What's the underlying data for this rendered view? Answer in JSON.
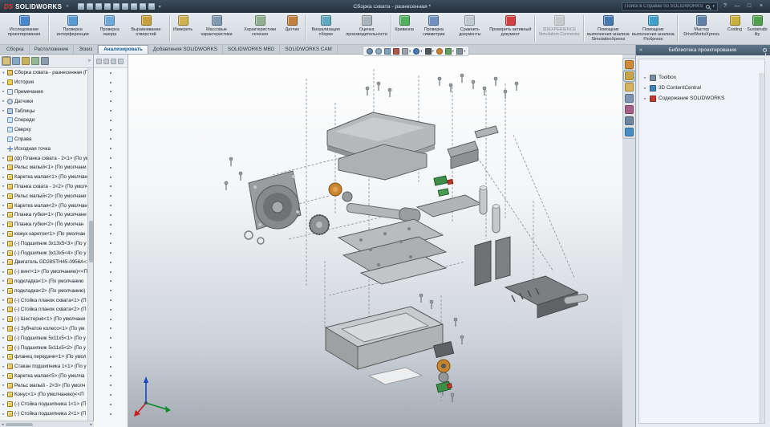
{
  "glyphs": {
    "dropdown": "▾",
    "expand": "▸",
    "expand_open": "▾",
    "chevron_left": "«",
    "chevron_right": "»",
    "scroll_left": "◂",
    "scroll_right": "▸"
  },
  "titlebar": {
    "logo_primary": "DS",
    "logo_name": "SOLIDWORKS",
    "doc_title": "Сборка схвата - разнесенная *",
    "search": {
      "placeholder": "Поиск в Справке по SOLIDWORKS"
    },
    "quick_access": [
      "new-document-icon",
      "open-icon",
      "save-icon",
      "print-icon",
      "undo-icon",
      "select-icon",
      "rebuild-icon",
      "file-properties-icon",
      "options-icon"
    ],
    "window_controls": {
      "help": "?",
      "dropdown": "▾",
      "min": "—",
      "max": "□",
      "close": "×"
    }
  },
  "ribbon": {
    "tools": [
      {
        "label": "Исследование проектирования",
        "icon": "design-study-icon",
        "color": "#4a86c8",
        "sep": true
      },
      {
        "label": "Проверка интерференции",
        "icon": "interference-check-icon",
        "color": "#5a9ad0"
      },
      {
        "label": "Проверка зазора",
        "icon": "clearance-check-icon",
        "color": "#70a8d8"
      },
      {
        "label": "Выравнивание отверстий",
        "icon": "hole-alignment-icon",
        "color": "#c8a040",
        "sep": true
      },
      {
        "label": "Измерить",
        "icon": "measure-icon",
        "color": "#d0b050"
      },
      {
        "label": "Массовые характеристики",
        "icon": "mass-properties-icon",
        "color": "#8098b0"
      },
      {
        "label": "Характеристики сечения",
        "icon": "section-properties-icon",
        "color": "#90b090"
      },
      {
        "label": "Датчик",
        "icon": "sensor-icon",
        "color": "#c08040",
        "sep": true
      },
      {
        "label": "Визуализация сборки",
        "icon": "assembly-visualization-icon",
        "color": "#60a8c0"
      },
      {
        "label": "Оценка производительности",
        "icon": "performance-evaluation-icon",
        "color": "#aab4bc",
        "sep": true
      },
      {
        "label": "Кривизна",
        "icon": "curvature-icon",
        "color": "#50b060"
      },
      {
        "label": "Проверка симметрии",
        "icon": "symmetry-check-icon",
        "color": "#7090c0"
      },
      {
        "label": "Сравнить документы",
        "icon": "compare-documents-icon",
        "color": "#c0c8d0"
      },
      {
        "label": "Проверить активный документ",
        "icon": "check-active-document-icon",
        "color": "#d04040",
        "sep": true
      },
      {
        "label": "3DEXPERIENCE Simulation Connector",
        "icon": "simulation-connector-icon",
        "color": "#a8b0b8",
        "disabled": true,
        "sep": true
      },
      {
        "label": "Помощник выполнения анализа SimulationXpress",
        "icon": "simulationxpress-icon",
        "color": "#4878b0"
      },
      {
        "label": "Помощник выполнения анализа FloXpress",
        "icon": "floxpress-icon",
        "color": "#40a0c8",
        "sep": true
      },
      {
        "label": "Мастер DriveWorksXpress",
        "icon": "driveworksxpress-icon",
        "color": "#6080a8"
      },
      {
        "label": "Costing",
        "icon": "costing-icon",
        "color": "#c8b040"
      },
      {
        "label": "Sustainability",
        "icon": "sustainability-icon",
        "color": "#50a050"
      }
    ]
  },
  "tabs": {
    "active_index": 3,
    "items": [
      "Сборка",
      "Расположение",
      "Эскиз",
      "Анализировать",
      "Добавления SOLIDWORKS",
      "SOLIDWORKS MBD",
      "SOLIDWORKS CAM"
    ]
  },
  "headsup": {
    "icons": [
      {
        "name": "zoom-fit-icon",
        "color": "#6b8aa8",
        "round": true
      },
      {
        "name": "zoom-area-icon",
        "color": "#8fa8c0",
        "round": true
      },
      {
        "name": "previous-view-icon",
        "color": "#7fa0c0"
      },
      {
        "name": "section-view-icon",
        "color": "#b05a4a"
      },
      {
        "name": "view-orientation-icon",
        "color": "#9aa4ae",
        "dd": true
      },
      {
        "name": "display-style-icon",
        "color": "#4a7ab0",
        "dd": true,
        "round": true
      },
      {
        "name": "hide-show-items-icon",
        "color": "#50585e",
        "dd": true
      },
      {
        "name": "edit-appearance-icon",
        "color": "#d08030",
        "round": true
      },
      {
        "name": "apply-scene-icon",
        "color": "#60a060",
        "dd": true
      },
      {
        "name": "view-settings-icon",
        "color": "#8090a0",
        "dd": true
      }
    ]
  },
  "feature_panel": {
    "tab_icons": [
      {
        "name": "feature-tree-icon",
        "color": "#d7c17a",
        "active": true
      },
      {
        "name": "property-manager-icon",
        "color": "#86a7c6"
      },
      {
        "name": "configuration-manager-icon",
        "color": "#c9b05e"
      },
      {
        "name": "dimxpert-manager-icon",
        "color": "#93b893"
      },
      {
        "name": "display-manager-icon",
        "color": "#8a9cae"
      }
    ],
    "tree": [
      {
        "label": "Сборка схвата - разнесенная  (По у",
        "icon": "assembly",
        "arrow": "▾"
      },
      {
        "label": "История",
        "icon": "folder",
        "arrow": "▸"
      },
      {
        "label": "Примечания",
        "icon": "annotations",
        "arrow": "▸"
      },
      {
        "label": "Датчики",
        "icon": "sensors",
        "arrow": "▸"
      },
      {
        "label": "Таблицы",
        "icon": "tables",
        "arrow": "▸"
      },
      {
        "label": "Спереди",
        "icon": "plane",
        "arrow": ""
      },
      {
        "label": "Сверху",
        "icon": "plane",
        "arrow": ""
      },
      {
        "label": "Справа",
        "icon": "plane",
        "arrow": ""
      },
      {
        "label": "Исходная точка",
        "icon": "origin",
        "arrow": ""
      },
      {
        "label": "(ф) Планка схвата - 2<1> (По ум",
        "icon": "part",
        "arrow": "▸"
      },
      {
        "label": "Рельс малый<1> (По умолчани",
        "icon": "part",
        "arrow": "▸"
      },
      {
        "label": "Каретка малая<1> (По умолчан",
        "icon": "part",
        "arrow": "▸"
      },
      {
        "label": "Планка схвата - 1<2> (По умолч",
        "icon": "part",
        "arrow": "▸"
      },
      {
        "label": "Рельс малый<2> (По умолчани",
        "icon": "part",
        "arrow": "▸"
      },
      {
        "label": "Каретка малая<2> (По умолчан",
        "icon": "part",
        "arrow": "▸"
      },
      {
        "label": "Планка губки<1> (По умолчани",
        "icon": "part",
        "arrow": "▸"
      },
      {
        "label": "Планка губки<2> (По умолчан",
        "icon": "part",
        "arrow": "▸"
      },
      {
        "label": "кожух кареток<1> (По умолчан",
        "icon": "part",
        "arrow": "▸"
      },
      {
        "label": "(-) Подшипник 3x13x5<3> (По у",
        "icon": "part",
        "arrow": "▸"
      },
      {
        "label": "(-) Подшипник 3x13x5<4> (По у",
        "icon": "part",
        "arrow": "▸"
      },
      {
        "label": "Двигатель GD28STH45-0956A<1",
        "icon": "part",
        "arrow": "▸"
      },
      {
        "label": "(-) винт<1> (По умолчанию)<<П",
        "icon": "part",
        "arrow": "▸"
      },
      {
        "label": "подкладка<1> (По умолчанию",
        "icon": "part",
        "arrow": "▸"
      },
      {
        "label": "подкладка<2> (По умолчанию)",
        "icon": "part",
        "arrow": "▸"
      },
      {
        "label": "(-) Стойка планок схвата<1> (П",
        "icon": "part",
        "arrow": "▸"
      },
      {
        "label": "(-) Стойка планок схвата<2> (П",
        "icon": "part",
        "arrow": "▸"
      },
      {
        "label": "(-) Шестерня<1> (По умолчани",
        "icon": "part",
        "arrow": "▸"
      },
      {
        "label": "(-) Зубчатое колесо<1> (По ум",
        "icon": "part",
        "arrow": "▸"
      },
      {
        "label": "(-) Подшипник 5x11x5<1> (По у",
        "icon": "part",
        "arrow": "▸"
      },
      {
        "label": "(-) Подшипник 5x11x5<2> (По у",
        "icon": "part",
        "arrow": "▸"
      },
      {
        "label": "фланец передачи<1> (По умол",
        "icon": "part",
        "arrow": "▸"
      },
      {
        "label": "Стакан подшипника 1<1> (По у",
        "icon": "part",
        "arrow": "▸"
      },
      {
        "label": "Каретка малая<5> (По умолча",
        "icon": "part",
        "arrow": "▸"
      },
      {
        "label": "Рельс малый - 2<3> (По умолч",
        "icon": "part",
        "arrow": "▸"
      },
      {
        "label": "Конус<1> (По умолчанию)<<П",
        "icon": "part",
        "arrow": "▸"
      },
      {
        "label": "(-) Стойка подшипника 1<1> (П",
        "icon": "part",
        "arrow": "▸"
      },
      {
        "label": "(-) Стойка подшипника 2<1> (П",
        "icon": "part",
        "arrow": "▸"
      }
    ]
  },
  "display_pane": {
    "rows": 37,
    "header_icons": [
      "hide-show-column-icon",
      "display-mode-column-icon",
      "appearance-column-icon",
      "transparency-column-icon"
    ]
  },
  "task_pane": {
    "title": "Библиотека проектирования",
    "items": [
      {
        "label": "Toolbox",
        "icon": "toolbox-icon",
        "color": "#7a8ea0"
      },
      {
        "label": "3D ContentCentral",
        "icon": "content-central-icon",
        "color": "#3f86c0"
      },
      {
        "label": "Содержание SOLIDWORKS",
        "icon": "solidworks-content-icon",
        "color": "#c23a2e"
      }
    ],
    "strip_icons": [
      {
        "name": "solidworks-resources-icon",
        "color": "#d08a3a"
      },
      {
        "name": "design-library-icon",
        "color": "#c8a545",
        "active": true
      },
      {
        "name": "file-explorer-icon",
        "color": "#d9b45c"
      },
      {
        "name": "view-palette-icon",
        "color": "#7e96b4"
      },
      {
        "name": "appearances-icon",
        "color": "#a85f86"
      },
      {
        "name": "custom-properties-icon",
        "color": "#6e86a0"
      },
      {
        "name": "forum-icon",
        "color": "#4a8cc4"
      }
    ]
  }
}
